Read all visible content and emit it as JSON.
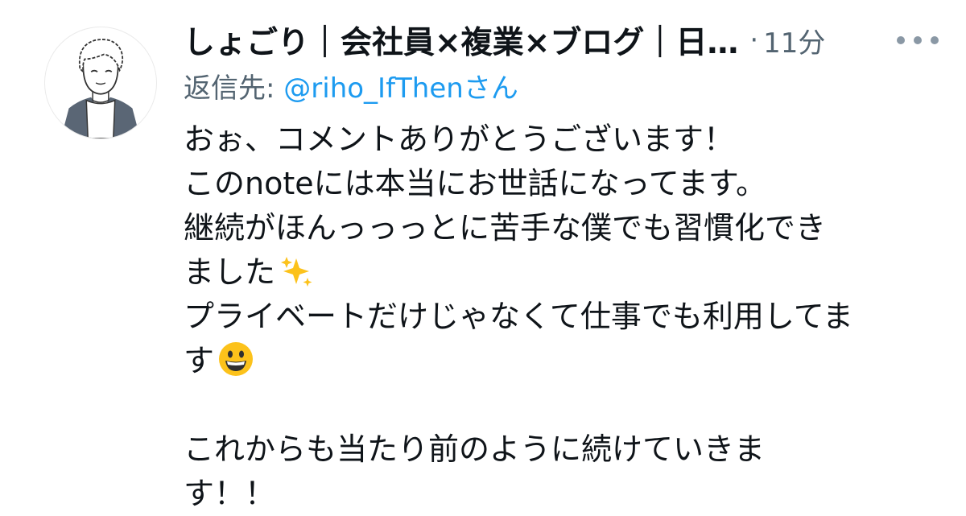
{
  "author": {
    "display_name": "しょごり｜会社員×複業×ブログ｜日…",
    "avatar_icon": "avatar-illustration-icon"
  },
  "separator": "·",
  "timestamp": "11分",
  "reply": {
    "prefix": "返信先: ",
    "mention": "@riho_IfThen",
    "suffix": "さん"
  },
  "tweet_lines": [
    "おぉ、コメントありがとうございます！",
    "このnoteには本当にお世話になってます。",
    "継続がほんっっっとに苦手な僕でも習慣化でき",
    "ました",
    "プライベートだけじゃなくて仕事でも利用してま",
    "す",
    "",
    "これからも当たり前のように続けていきま",
    "す！！"
  ],
  "emojis": {
    "sparkles": "sparkles-icon",
    "grinning": "grinning-face-icon"
  },
  "colors": {
    "text": "#0f1419",
    "secondary": "#536471",
    "link": "#1d9bf0"
  }
}
